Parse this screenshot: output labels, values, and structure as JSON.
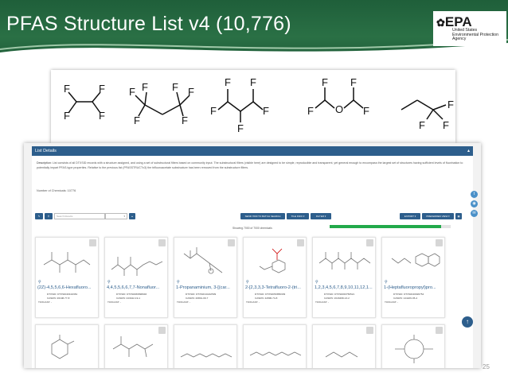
{
  "slide": {
    "title": "PFAS Structure List v4 (10,776)",
    "page_number": "25"
  },
  "epa": {
    "logo": "EPA",
    "agency_line1": "United States",
    "agency_line2": "Environmental Protection",
    "agency_line3": "Agency"
  },
  "structure_strip": {
    "atom_label": "F",
    "oxygen_label": "O"
  },
  "app": {
    "list_details_title": "List Details",
    "description_label": "Description:",
    "description_text": "List consists of all DTXSID records with a structure assigned, and using a set of substructural filters based on community input. The substructural filters (visible here) are designed to be simple, reproducible and transparent, yet general enough to encompass the largest set of structures having sufficient levels of fluorination to potentially impart PFAS-type properties. Relative to the previous list (PFASSTRUCTv3) the trifluoroacetate substructure has been removed from the substructure filters.",
    "num_chemicals_label": "Number of Chemicals:",
    "num_chemicals_value": "10776",
    "search_placeholder": "Search Results",
    "btn_send_batch": "SEND 7000 TO BATCH SEARCH",
    "btn_tile_info": "TILE INFO ▾",
    "btn_filter": "FILTER ▾",
    "btn_export": "EXPORT ▾",
    "btn_preferred_view": "PREFERRED VIEW ▾",
    "showing_text": "Showing 7000 of 7000 chemicals",
    "progress": 0.92,
    "cards": [
      {
        "name": "(2Z)-4,5,5,6,6-Hexafluoro...",
        "dtxsid": "DTXSID: DTXSID40102381",
        "casrn": "CASRN: 26198-77-8",
        "toxcast": "TOXCAST: -"
      },
      {
        "name": "4,4,5,5,6,6,7,7-Nonafluor...",
        "dtxsid": "DTXSID: DTXSID80898946",
        "casrn": "CASRN: 243442-19-1",
        "toxcast": "TOXCAST: -"
      },
      {
        "name": "1-Propanaminium, 3-[(car...",
        "dtxsid": "DTXSID: DTXSID10222599",
        "casrn": "CASRN: 20801-09-7",
        "toxcast": "TOXCAST: -"
      },
      {
        "name": "2-[2,3,3,3-Tetrafluoro-2-(tri...",
        "dtxsid": "DTXSID: DTXSID50856309",
        "casrn": "CASRN: 42896-74-8",
        "toxcast": "TOXCAST: -"
      },
      {
        "name": "1,2,3,4,5,6,7,8,9,10,11,12,1...",
        "dtxsid": "DTXSID: DTXSID60750521",
        "casrn": "CASRN: 1643498-13-2",
        "toxcast": "TOXCAST: -"
      },
      {
        "name": "1-(Heptafluoropropyl)pro...",
        "dtxsid": "DTXSID: DTXSID40926754",
        "casrn": "CASRN: 144229-35-4",
        "toxcast": "TOXCAST: -"
      }
    ]
  }
}
